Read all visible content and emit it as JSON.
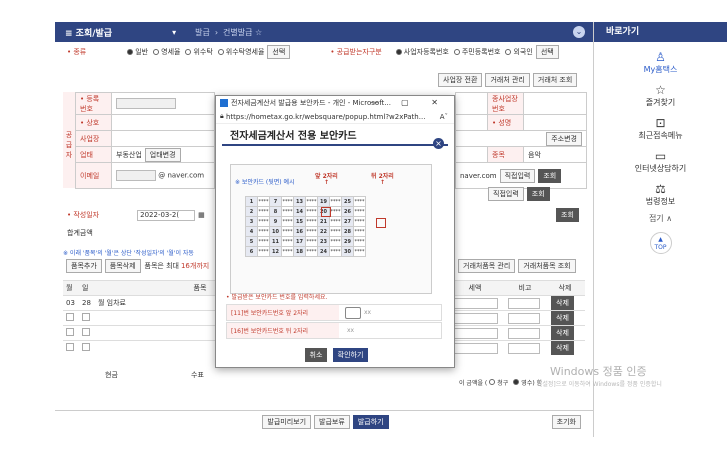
{
  "topbar": {
    "menu": "≡ 조회/발급",
    "dropdown": "▾",
    "crumb1": "발급",
    "crumb2": "건별발급 ☆",
    "chevron": "⌄"
  },
  "sidebar": {
    "header": "바로가기",
    "items": [
      {
        "icon": "person-icon",
        "glyph": "♙",
        "label": "My홈택스",
        "blue": true
      },
      {
        "icon": "star-icon",
        "glyph": "☆",
        "label": "즐겨찾기"
      },
      {
        "icon": "recent-icon",
        "glyph": "⊡",
        "label": "최근접속메뉴"
      },
      {
        "icon": "chat-icon",
        "glyph": "▭",
        "label": "인터넷상담하기"
      },
      {
        "icon": "law-icon",
        "glyph": "⚖",
        "label": "법령정보"
      }
    ],
    "fold": "접기 ∧",
    "top_btn": "TOP"
  },
  "form": {
    "type_label": "• 종류",
    "type_opts": [
      "일반",
      "영세율",
      "위수탁",
      "위수탁영세율"
    ],
    "select": "선택",
    "buyer_label": "• 공급받는자구분",
    "buyer_opts": [
      "사업자등록번호",
      "주민등록번호",
      "외국인"
    ],
    "btn_bizcheck": "사업장 전환",
    "btn_client_mgmt": "거래처 관리",
    "btn_client_search": "거래처 조회",
    "reg_no": "• 등록\n번호",
    "jong": "종사업장\n번호",
    "sangho": "• 상호",
    "seongmyeong": "• 성명",
    "address": "주소변경",
    "uptae": "업태",
    "uptae_val": "부동산업",
    "uptae_btn": "업태변경",
    "jongmok": "종목",
    "jongmok_val": "음악",
    "email": "이메일",
    "email_dom": "naver.com",
    "email_dom2": "naver.com",
    "direct": "직접입력",
    "lookup": "조회",
    "jakseong": "• 작성일자",
    "jakseong_val": "2022-03-2(",
    "total": "합계금액",
    "note": "※ 이래 '품목'의 '월'은 상단 '작성일자'의 '월'이 자동",
    "add_item": "품목추가",
    "del_item": "품목삭제",
    "item_note": "품목은 최대",
    "item_max": "16개까지",
    "btn_item_mgmt": "거래처품목 관리",
    "btn_item_search": "거래처품목 조회",
    "col_month": "월",
    "col_day": "일",
    "col_item": "품목",
    "col_tax": "세액",
    "col_note": "비고",
    "col_del": "삭제",
    "row1_month": "03",
    "row1_day": "28",
    "row1_item": "월 임차료",
    "del": "삭제",
    "cash": "현금",
    "check": "수표",
    "bill_text": "이 금액을 (",
    "bill_opt1": "청구",
    "bill_opt2": "영수",
    "bill_end": ") 함",
    "btn_preview": "발급미리보기",
    "btn_hold": "발급보류",
    "btn_issue": "발급하기",
    "btn_reset": "초기화"
  },
  "popup": {
    "title": "전자세금계산서 발급용 보안카드 - 개인 - Microsoft...",
    "controls": "— ▢ ✕",
    "url": "https://hometax.go.kr/websquare/popup.html?w2xPath...",
    "reader": "Aˇ",
    "header": "전자세금계산서 전용 보안카드",
    "close": "×",
    "card_label": "※ 보안카드 (뒷면) 예시",
    "ann_front": "앞 2자리",
    "ann_back": "뒤 2자리",
    "grid": [
      [
        "1",
        "****",
        "7",
        "****",
        "13",
        "****",
        "19",
        "****",
        "25",
        "****"
      ],
      [
        "2",
        "****",
        "8",
        "****",
        "14",
        "****",
        "20",
        "****",
        "26",
        "****"
      ],
      [
        "3",
        "****",
        "9",
        "****",
        "15",
        "****",
        "21",
        "****",
        "27",
        "****"
      ],
      [
        "4",
        "****",
        "10",
        "****",
        "16",
        "****",
        "22",
        "****",
        "28",
        "****"
      ],
      [
        "5",
        "****",
        "11",
        "****",
        "17",
        "****",
        "23",
        "****",
        "29",
        "****"
      ],
      [
        "6",
        "****",
        "12",
        "****",
        "18",
        "****",
        "24",
        "****",
        "30",
        "****"
      ]
    ],
    "info": "• 발급받은 보안카드 번호를 입력하세요.",
    "row1": "[11]번 보안카드번호 앞 2자리",
    "row2": "[16]번 보안카드번호 뒤 2자리",
    "ph": "xx",
    "cancel": "취소",
    "confirm": "확인하기"
  },
  "watermark": {
    "line1": "Windows 정품 인증",
    "line2": "[설정]으로 이동하여 Windows를 정품 인증합니"
  }
}
